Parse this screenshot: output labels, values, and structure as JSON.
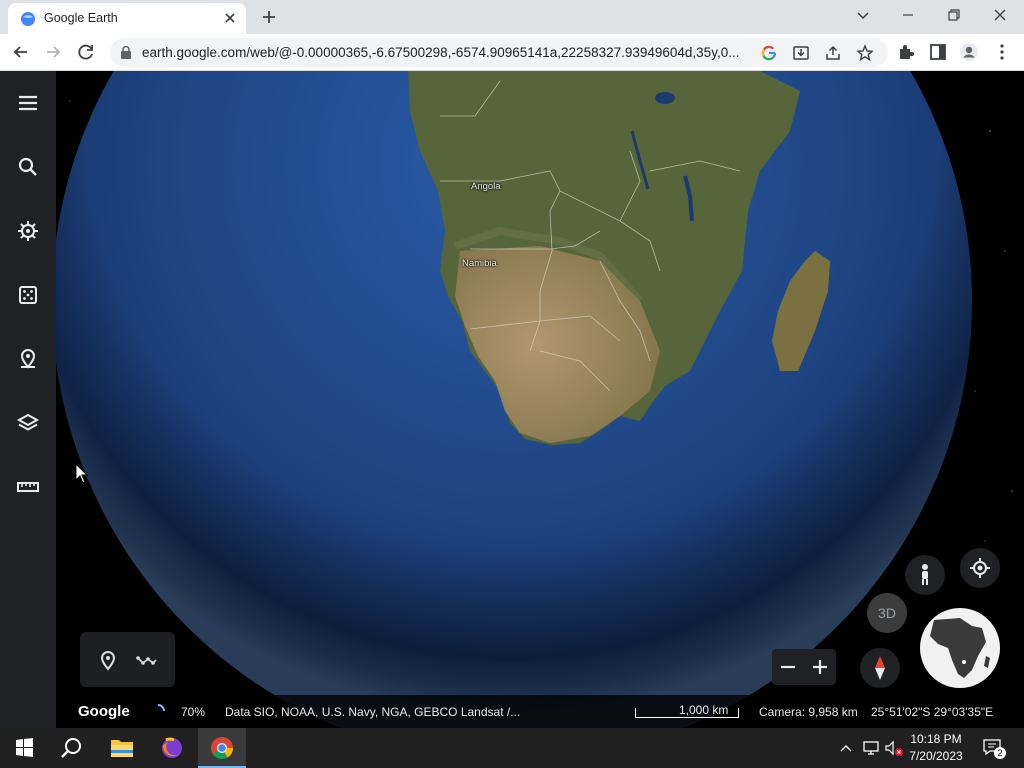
{
  "browser": {
    "tab_title": "Google Earth",
    "url_domain": "earth.google.com",
    "url_rest": "/web/@-0.00000365,-6.67500298,-6574.90965141a,22258327.93949604d,35y,0...",
    "icons": [
      "back-icon",
      "forward-icon",
      "reload-icon",
      "lock-icon",
      "google-icon",
      "install-icon",
      "share-icon",
      "star-icon",
      "extensions-icon",
      "sidepanel-icon",
      "profile-icon",
      "menu-icon"
    ]
  },
  "sidebar": {
    "items": [
      {
        "icon": "menu-icon"
      },
      {
        "icon": "search-icon"
      },
      {
        "icon": "voyager-icon"
      },
      {
        "icon": "feeling-lucky-icon"
      },
      {
        "icon": "projects-icon"
      },
      {
        "icon": "map-style-icon"
      },
      {
        "icon": "measure-icon"
      }
    ]
  },
  "map": {
    "labels": {
      "angola": "Angola",
      "namibia": "Namibia"
    }
  },
  "controls": {
    "btn_3d": "3D",
    "zoom_out": "−",
    "zoom_in": "+"
  },
  "status": {
    "logo": "Google",
    "progress": "70%",
    "attribution": "Data SIO, NOAA, U.S. Navy, NGA, GEBCO   Landsat /...",
    "scale": "1,000 km",
    "camera": "Camera: 9,958 km",
    "coords": "25°51'02\"S 29°03'35\"E"
  },
  "taskbar": {
    "time": "10:18 PM",
    "date": "7/20/2023",
    "notifications": "2"
  },
  "colors": {
    "ocean": "#1f4a8a",
    "land": "#5d6b3a",
    "desert": "#b08a62",
    "panel": "#202124"
  }
}
